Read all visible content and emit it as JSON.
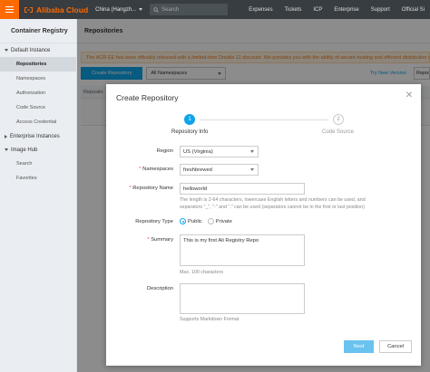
{
  "topbar": {
    "logo_text": "Alibaba Cloud",
    "region": "China (Hangzh...",
    "search_placeholder": "Search",
    "links": [
      "Expenses",
      "Tickets",
      "ICP",
      "Enterprise",
      "Support",
      "Official Si"
    ]
  },
  "sidebar": {
    "title": "Container Registry",
    "groups": [
      {
        "label": "Default Instance",
        "expanded": true,
        "items": [
          "Repositories",
          "Namespaces",
          "Authorization",
          "Code Source",
          "Access Credential"
        ]
      },
      {
        "label": "Enterprise Instances",
        "expanded": false,
        "items": []
      },
      {
        "label": "Image Hub",
        "expanded": true,
        "items": [
          "Search",
          "Favorites"
        ]
      }
    ],
    "active_item": "Repositories"
  },
  "main": {
    "header": "Repositories",
    "notice": "The ACR EE has been officially released with a limited-time Double 11 discount. We provides you with the ability of secure hosting and efficient distribution of",
    "create_button": "Create Repository",
    "namespace_select": "All Namespaces",
    "try_new_version": "Try New Version",
    "repo_side_button": "Reposit",
    "table_first_col": "Reposito"
  },
  "modal": {
    "title": "Create Repository",
    "steps": [
      {
        "number": "1",
        "label": "Repository Info",
        "active": true
      },
      {
        "number": "2",
        "label": "Code Source",
        "active": false
      }
    ],
    "fields": {
      "region_label": "Region",
      "region_value": "US (Virginia)",
      "namespace_label": "Namespaces",
      "namespace_value": "freshbrewed",
      "repo_name_label": "Repository Name",
      "repo_name_value": "helloworld",
      "repo_name_hint_1": "The length is 2-64 characters, lowercase English letters and numbers can be used, and",
      "repo_name_hint_2": "separators \"_\", \"-\" and \".\" can be used (separators cannot be in the first or last position)",
      "type_label": "Repository Type",
      "type_public": "Public",
      "type_private": "Private",
      "type_selected": "Public",
      "summary_label": "Summary",
      "summary_value": "This is my first Ali Registry Repo",
      "summary_hint": "Max. 100 characters",
      "description_label": "Description",
      "description_value": "",
      "description_hint": "Supports Markdown Format"
    },
    "next_button": "Next",
    "cancel_button": "Cancel",
    "close_icon": "close-icon"
  },
  "colors": {
    "brand_orange": "#ff6a00",
    "primary_blue": "#0ea4e9",
    "topbar_bg": "#373d41",
    "sidebar_bg": "#eaedf1"
  }
}
